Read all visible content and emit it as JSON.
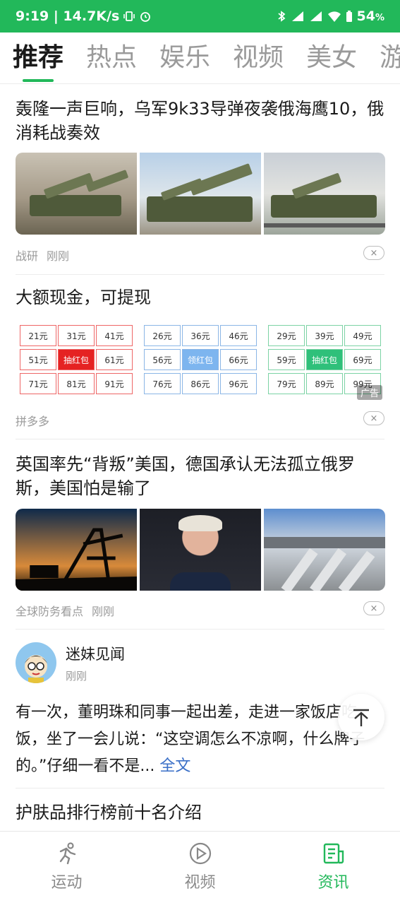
{
  "status_bar": {
    "time_speed": "9:19 | 14.7K/s",
    "battery": "54",
    "battery_unit": "%"
  },
  "tabs": [
    {
      "label": "推荐",
      "active": true
    },
    {
      "label": "热点",
      "active": false
    },
    {
      "label": "娱乐",
      "active": false
    },
    {
      "label": "视频",
      "active": false
    },
    {
      "label": "美女",
      "active": false
    },
    {
      "label": "游",
      "active": false
    }
  ],
  "feed": [
    {
      "title": "轰隆一声巨响，乌军9k33导弹夜袭俄海鹰10，俄消耗战奏效",
      "source": "战研",
      "time": "刚刚"
    },
    {
      "title": "大额现金，可提现",
      "source": "拼多多",
      "ad_label": "广告",
      "ad_panels": [
        {
          "cells": [
            "21元",
            "31元",
            "41元",
            "51元",
            "抽红包",
            "61元",
            "71元",
            "81元",
            "91元"
          ]
        },
        {
          "cells": [
            "26元",
            "36元",
            "46元",
            "56元",
            "领红包",
            "66元",
            "76元",
            "86元",
            "96元"
          ]
        },
        {
          "cells": [
            "29元",
            "39元",
            "49元",
            "59元",
            "抽红包",
            "69元",
            "79元",
            "89元",
            "99元"
          ]
        }
      ]
    },
    {
      "title": "英国率先“背叛”美国，德国承认无法孤立俄罗斯，美国怕是输了",
      "source": "全球防务看点",
      "time": "刚刚"
    }
  ],
  "post": {
    "author": "迷妹见闻",
    "time": "刚刚",
    "text": "有一次，董明珠和同事一起出差，走进一家饭店吃饭，坐了一会儿说：“这空调怎么不凉啊，什么牌子的。”仔细一看不是...",
    "more_link": "全文"
  },
  "next_title": "护肤品排行榜前十名介绍",
  "close_symbol": "×",
  "bottom_nav": [
    {
      "label": "运动",
      "icon": "running-icon",
      "active": false
    },
    {
      "label": "视频",
      "icon": "play-icon",
      "active": false
    },
    {
      "label": "资讯",
      "icon": "news-icon",
      "active": true
    }
  ],
  "colors": {
    "accent": "#22b85a",
    "link": "#3a6fc7"
  }
}
